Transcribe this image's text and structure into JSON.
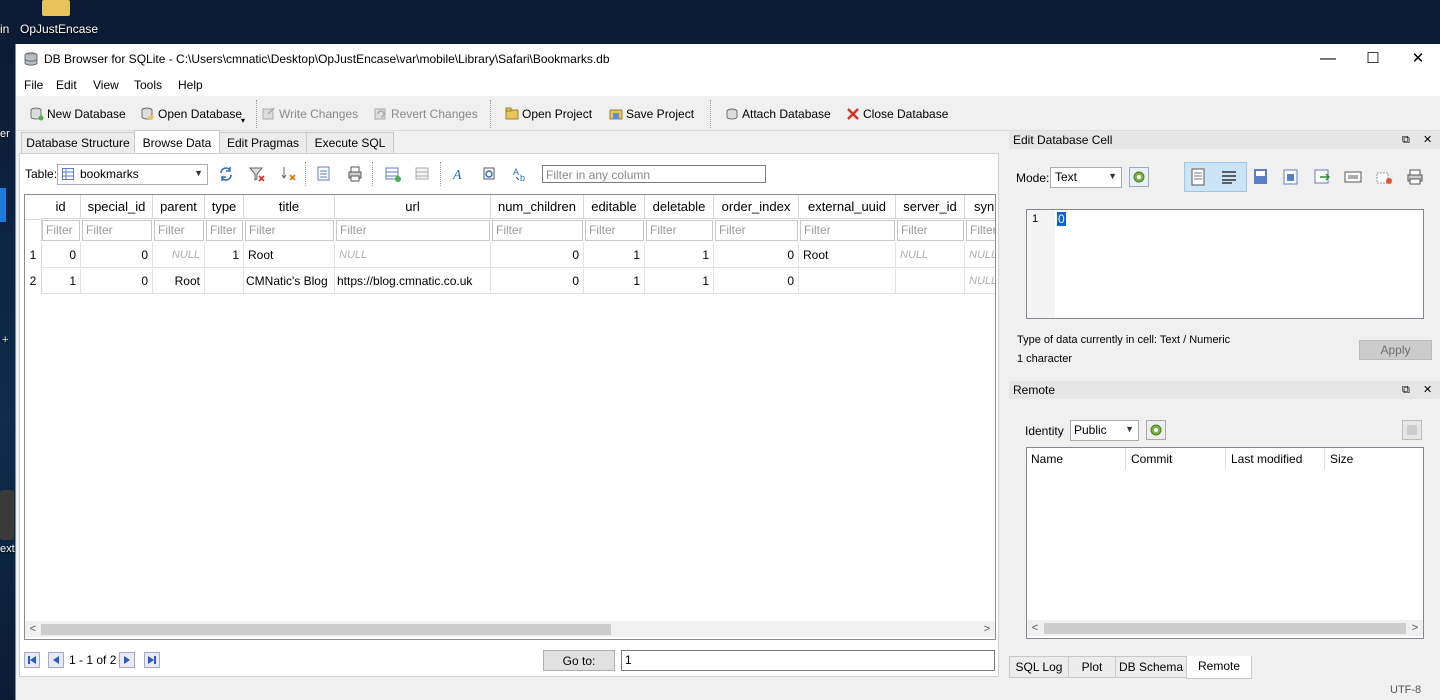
{
  "desktop": {
    "icon_label": "OpJustEncase",
    "left_labels": [
      "in",
      "er",
      "+",
      "ext"
    ]
  },
  "window": {
    "title": "DB Browser for SQLite - C:\\Users\\cmnatic\\Desktop\\OpJustEncase\\var\\mobile\\Library\\Safari\\Bookmarks.db",
    "controls": {
      "minimize": "—",
      "maximize": "☐",
      "close": "✕"
    }
  },
  "menu": [
    "File",
    "Edit",
    "View",
    "Tools",
    "Help"
  ],
  "toolbar": {
    "new_database": "New Database",
    "open_database": "Open Database",
    "write_changes": "Write Changes",
    "revert_changes": "Revert Changes",
    "open_project": "Open Project",
    "save_project": "Save Project",
    "attach_database": "Attach Database",
    "close_database": "Close Database"
  },
  "tabs": [
    "Database Structure",
    "Browse Data",
    "Edit Pragmas",
    "Execute SQL"
  ],
  "active_tab": "Browse Data",
  "browse": {
    "table_label": "Table:",
    "table_value": "bookmarks",
    "filter_all_placeholder": "Filter in any column",
    "columns": [
      "id",
      "special_id",
      "parent",
      "type",
      "title",
      "url",
      "num_children",
      "editable",
      "deletable",
      "order_index",
      "external_uuid",
      "server_id",
      "syn"
    ],
    "filter_placeholder": "Filter",
    "null_text": "NULL",
    "rows": [
      {
        "n": "1",
        "cells": [
          "0",
          "0",
          "NULL",
          "1",
          "Root",
          "NULL",
          "0",
          "1",
          "1",
          "0",
          "Root",
          "NULL",
          "NULL"
        ]
      },
      {
        "n": "2",
        "cells": [
          "1",
          "0",
          "Root",
          "",
          "CMNatic's Blog",
          "https://blog.cmnatic.co.uk",
          "0",
          "1",
          "1",
          "0",
          "",
          "",
          "NULL"
        ]
      }
    ],
    "record_count": "1 - 1 of 2",
    "goto_label": "Go to:",
    "goto_value": "1"
  },
  "edit_cell": {
    "title": "Edit Database Cell",
    "mode_label": "Mode:",
    "mode_value": "Text",
    "line_number": "1",
    "content": "0",
    "type_info": "Type of data currently in cell: Text / Numeric",
    "size_info": "1 character",
    "apply": "Apply"
  },
  "remote": {
    "title": "Remote",
    "identity_label": "Identity",
    "identity_value": "Public",
    "columns": [
      "Name",
      "Commit",
      "Last modified",
      "Size"
    ]
  },
  "bottom_tabs": [
    "SQL Log",
    "Plot",
    "DB Schema",
    "Remote"
  ],
  "active_bottom_tab": "Remote",
  "status": {
    "encoding": "UTF-8"
  },
  "colors": {
    "accent_blue": "#0a64d8",
    "close_red": "#d93025",
    "null_grey": "#b0b0b0"
  }
}
